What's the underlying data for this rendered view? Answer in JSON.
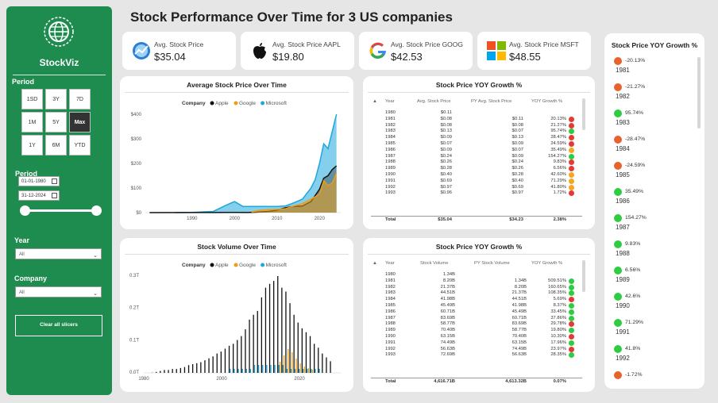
{
  "title": "Stock Performance Over Time for 3 US companies",
  "sidebar": {
    "brand": "StockViz",
    "period_label": "Period",
    "period_buttons": [
      "1SD",
      "3Y",
      "7D",
      "1M",
      "5Y",
      "Max",
      "1Y",
      "6M",
      "YTD"
    ],
    "active_button": "Max",
    "period_range_label": "Period",
    "date_from": "01-01-1980",
    "date_to": "31-12-2024",
    "year_label": "Year",
    "year_value": "All",
    "company_label": "Company",
    "company_value": "All",
    "clear_label": "Clear all slicers"
  },
  "kpis": [
    {
      "label": "Avg. Stock Price",
      "value": "$35.04",
      "icon": "stock-chart-icon"
    },
    {
      "label": "Avg. Stock Price AAPL",
      "value": "$19.80",
      "icon": "apple-logo-icon"
    },
    {
      "label": "Avg. Stock Price GOOG",
      "value": "$42.53",
      "icon": "google-logo-icon"
    },
    {
      "label": "Avg. Stock Price MSFT",
      "value": "$48.55",
      "icon": "microsoft-logo-icon"
    }
  ],
  "colors": {
    "apple": "#111111",
    "google": "#f39c12",
    "microsoft": "#1da7dd",
    "green": "#1e8b4f",
    "up": "#2ecc40",
    "down": "#e8632b"
  },
  "price_chart": {
    "title": "Average Stock Price Over Time",
    "legend_title": "Company",
    "legend": [
      "Apple",
      "Google",
      "Microsoft"
    ],
    "y_ticks": [
      "$400",
      "$300",
      "$200",
      "$100",
      "$0"
    ],
    "x_ticks": [
      "1990",
      "2000",
      "2010",
      "2020"
    ]
  },
  "volume_chart": {
    "title": "Stock Volume Over Time",
    "legend_title": "Company",
    "legend": [
      "Apple",
      "Google",
      "Microsoft"
    ],
    "y_ticks": [
      "0.3T",
      "0.2T",
      "0.1T",
      "0.0T"
    ],
    "x_ticks": [
      "1980",
      "2000",
      "2020"
    ]
  },
  "chart_data": [
    {
      "type": "area",
      "title": "Average Stock Price Over Time",
      "ylim": [
        0,
        400
      ],
      "series": [
        {
          "name": "Microsoft",
          "x": [
            1986,
            1990,
            1995,
            1998,
            2000,
            2002,
            2005,
            2008,
            2010,
            2012,
            2014,
            2016,
            2018,
            2019,
            2020,
            2021,
            2022,
            2023,
            2024
          ],
          "values": [
            0.1,
            1,
            5,
            30,
            45,
            25,
            25,
            25,
            25,
            27,
            40,
            55,
            100,
            135,
            200,
            280,
            260,
            330,
            400
          ]
        },
        {
          "name": "Apple",
          "x": [
            1980,
            1990,
            1995,
            2000,
            2003,
            2005,
            2008,
            2010,
            2012,
            2014,
            2016,
            2018,
            2020,
            2021,
            2022,
            2023,
            2024
          ],
          "values": [
            0.1,
            0.3,
            0.3,
            0.9,
            0.3,
            1.5,
            5,
            10,
            20,
            25,
            27,
            45,
            95,
            140,
            150,
            175,
            190
          ]
        },
        {
          "name": "Google",
          "x": [
            2004,
            2006,
            2008,
            2010,
            2012,
            2014,
            2016,
            2018,
            2020,
            2021,
            2022,
            2023,
            2024
          ],
          "values": [
            2.5,
            10,
            12,
            13,
            16,
            27,
            37,
            55,
            75,
            130,
            110,
            120,
            160
          ]
        }
      ]
    },
    {
      "type": "bar",
      "title": "Stock Volume Over Time",
      "ylim": [
        0,
        0.3
      ]
    },
    {
      "type": "table",
      "title": "Stock Price YOY Growth %",
      "columns": [
        "Year",
        "Avg. Stock Price",
        "PY Avg. Stock Price",
        "YOY Growth %"
      ],
      "rows": [
        [
          "1980",
          "$0.11",
          "",
          "",
          ""
        ],
        [
          "1981",
          "$0.08",
          "$0.11",
          "20.13%",
          "down"
        ],
        [
          "1982",
          "$0.08",
          "$0.08",
          "21.27%",
          "down"
        ],
        [
          "1983",
          "$0.13",
          "$0.07",
          "95.74%",
          "up"
        ],
        [
          "1984",
          "$0.09",
          "$0.13",
          "28.47%",
          "down"
        ],
        [
          "1985",
          "$0.07",
          "$0.09",
          "24.59%",
          "down"
        ],
        [
          "1986",
          "$0.09",
          "$0.07",
          "35.49%",
          "mid"
        ],
        [
          "1987",
          "$0.24",
          "$0.09",
          "154.27%",
          "up"
        ],
        [
          "1988",
          "$0.26",
          "$0.24",
          "9.83%",
          "down"
        ],
        [
          "1989",
          "$0.28",
          "$0.26",
          "6.56%",
          "down"
        ],
        [
          "1990",
          "$0.40",
          "$0.28",
          "42.60%",
          "mid"
        ],
        [
          "1991",
          "$0.69",
          "$0.40",
          "71.29%",
          "mid"
        ],
        [
          "1992",
          "$0.97",
          "$0.69",
          "41.80%",
          "mid"
        ],
        [
          "1993",
          "$0.96",
          "$0.97",
          "1.72%",
          "down"
        ]
      ],
      "total": [
        "Total",
        "$35.04",
        "$34.23",
        "2.38%"
      ]
    },
    {
      "type": "table",
      "title": "Stock Price YOY Growth %",
      "columns": [
        "Year",
        "Stock Volume",
        "PY Stock Volume",
        "YOY Growth %"
      ],
      "rows": [
        [
          "1980",
          "1.34B",
          "",
          "",
          ""
        ],
        [
          "1981",
          "8.20B",
          "1.34B",
          "509.51%",
          "up"
        ],
        [
          "1982",
          "21.37B",
          "8.20B",
          "160.65%",
          "up"
        ],
        [
          "1983",
          "44.51B",
          "21.37B",
          "108.35%",
          "up"
        ],
        [
          "1984",
          "41.98B",
          "44.51B",
          "5.69%",
          "down"
        ],
        [
          "1985",
          "45.49B",
          "41.98B",
          "8.37%",
          "up"
        ],
        [
          "1986",
          "60.71B",
          "45.49B",
          "33.45%",
          "up"
        ],
        [
          "1987",
          "83.69B",
          "60.71B",
          "37.86%",
          "up"
        ],
        [
          "1988",
          "58.77B",
          "83.69B",
          "29.78%",
          "down"
        ],
        [
          "1989",
          "70.40B",
          "58.77B",
          "19.80%",
          "up"
        ],
        [
          "1990",
          "63.15B",
          "70.40B",
          "10.30%",
          "down"
        ],
        [
          "1991",
          "74.49B",
          "63.15B",
          "17.96%",
          "up"
        ],
        [
          "1992",
          "56.63B",
          "74.49B",
          "23.97%",
          "down"
        ],
        [
          "1993",
          "72.69B",
          "56.63B",
          "28.35%",
          "up"
        ]
      ],
      "total": [
        "Total",
        "4,616.71B",
        "4,613.32B",
        "0.07%"
      ]
    }
  ],
  "yoy_list": {
    "title": "Stock Price YOY Growth %",
    "items": [
      {
        "pct": "-20.13%",
        "year": "1981",
        "dir": "down"
      },
      {
        "pct": "-21.27%",
        "year": "1982",
        "dir": "down"
      },
      {
        "pct": "95.74%",
        "year": "1983",
        "dir": "up"
      },
      {
        "pct": "-28.47%",
        "year": "1984",
        "dir": "down"
      },
      {
        "pct": "-24.59%",
        "year": "1985",
        "dir": "down"
      },
      {
        "pct": "35.49%",
        "year": "1986",
        "dir": "up"
      },
      {
        "pct": "154.27%",
        "year": "1987",
        "dir": "up"
      },
      {
        "pct": "9.83%",
        "year": "1988",
        "dir": "up"
      },
      {
        "pct": "6.56%",
        "year": "1989",
        "dir": "up"
      },
      {
        "pct": "42.6%",
        "year": "1990",
        "dir": "up"
      },
      {
        "pct": "71.29%",
        "year": "1991",
        "dir": "up"
      },
      {
        "pct": "41.8%",
        "year": "1992",
        "dir": "up"
      },
      {
        "pct": "-1.72%",
        "year": "",
        "dir": "down"
      }
    ]
  }
}
